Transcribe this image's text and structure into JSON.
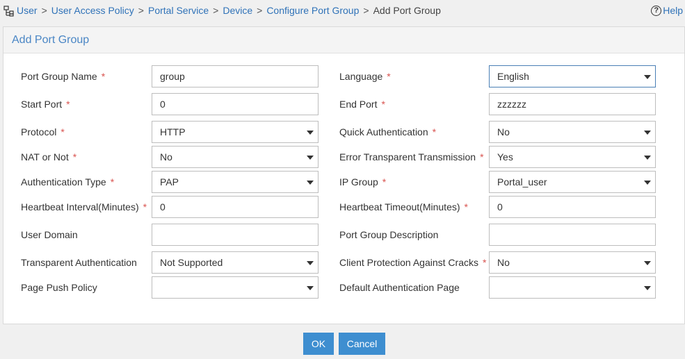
{
  "breadcrumb": {
    "items": [
      "User",
      "User Access Policy",
      "Portal Service",
      "Device",
      "Configure Port Group"
    ],
    "current": "Add Port Group",
    "separator": ">"
  },
  "help": {
    "label": "Help",
    "icon": "?"
  },
  "panel": {
    "title": "Add Port Group"
  },
  "required_mark": "*",
  "form": {
    "port_group_name": {
      "label": "Port Group Name",
      "value": "group"
    },
    "language": {
      "label": "Language",
      "value": "English"
    },
    "start_port": {
      "label": "Start Port",
      "value": "0"
    },
    "end_port": {
      "label": "End Port",
      "value": "zzzzzz"
    },
    "protocol": {
      "label": "Protocol",
      "value": "HTTP"
    },
    "quick_auth": {
      "label": "Quick Authentication",
      "value": "No"
    },
    "nat": {
      "label": "NAT or Not",
      "value": "No"
    },
    "error_transparent": {
      "label": "Error Transparent Transmission",
      "value": "Yes"
    },
    "auth_type": {
      "label": "Authentication Type",
      "value": "PAP"
    },
    "ip_group": {
      "label": "IP Group",
      "value": "Portal_user"
    },
    "heartbeat_interval": {
      "label": "Heartbeat Interval(Minutes)",
      "value": "0"
    },
    "heartbeat_timeout": {
      "label": "Heartbeat Timeout(Minutes)",
      "value": "0"
    },
    "user_domain": {
      "label": "User Domain",
      "value": ""
    },
    "port_group_desc": {
      "label": "Port Group Description",
      "value": ""
    },
    "transparent_auth": {
      "label": "Transparent Authentication",
      "value": "Not Supported"
    },
    "client_protection": {
      "label": "Client Protection Against Cracks",
      "value": "No"
    },
    "page_push": {
      "label": "Page Push Policy",
      "value": ""
    },
    "default_auth_page": {
      "label": "Default Authentication Page",
      "value": ""
    }
  },
  "buttons": {
    "ok": "OK",
    "cancel": "Cancel"
  },
  "colors": {
    "accent": "#3e8ed0",
    "link": "#2f72b8",
    "required": "#d9534f",
    "title": "#4a86c5"
  }
}
